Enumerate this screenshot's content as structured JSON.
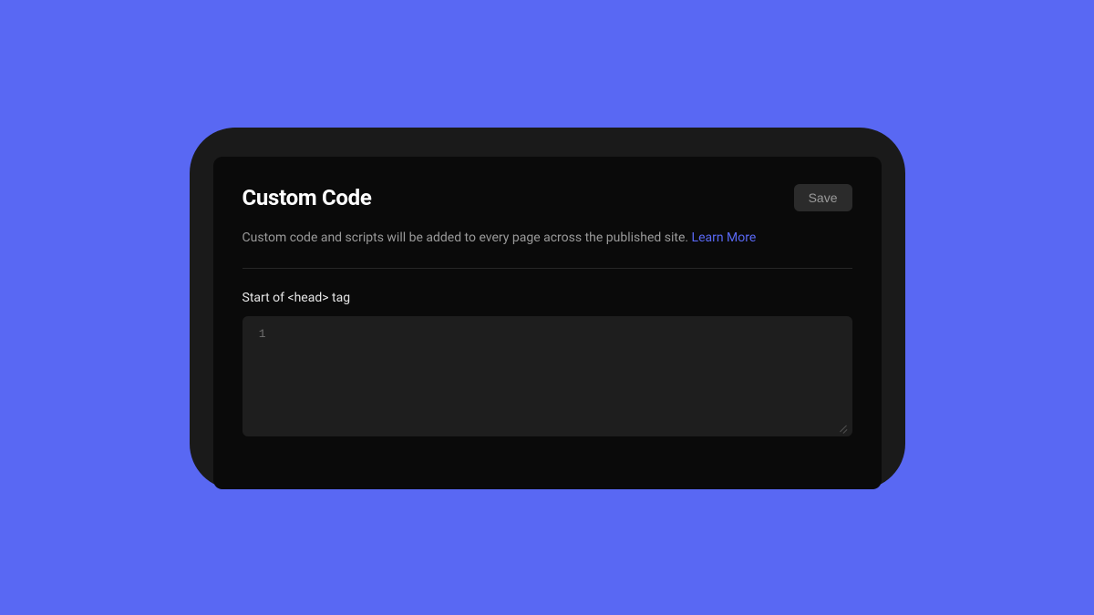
{
  "panel": {
    "title": "Custom Code",
    "save_label": "Save",
    "description": "Custom code and scripts will be added to every page across the published site. ",
    "learn_more": "Learn More",
    "section_label": "Start of <head> tag",
    "editor": {
      "line_number": "1",
      "value": ""
    }
  }
}
